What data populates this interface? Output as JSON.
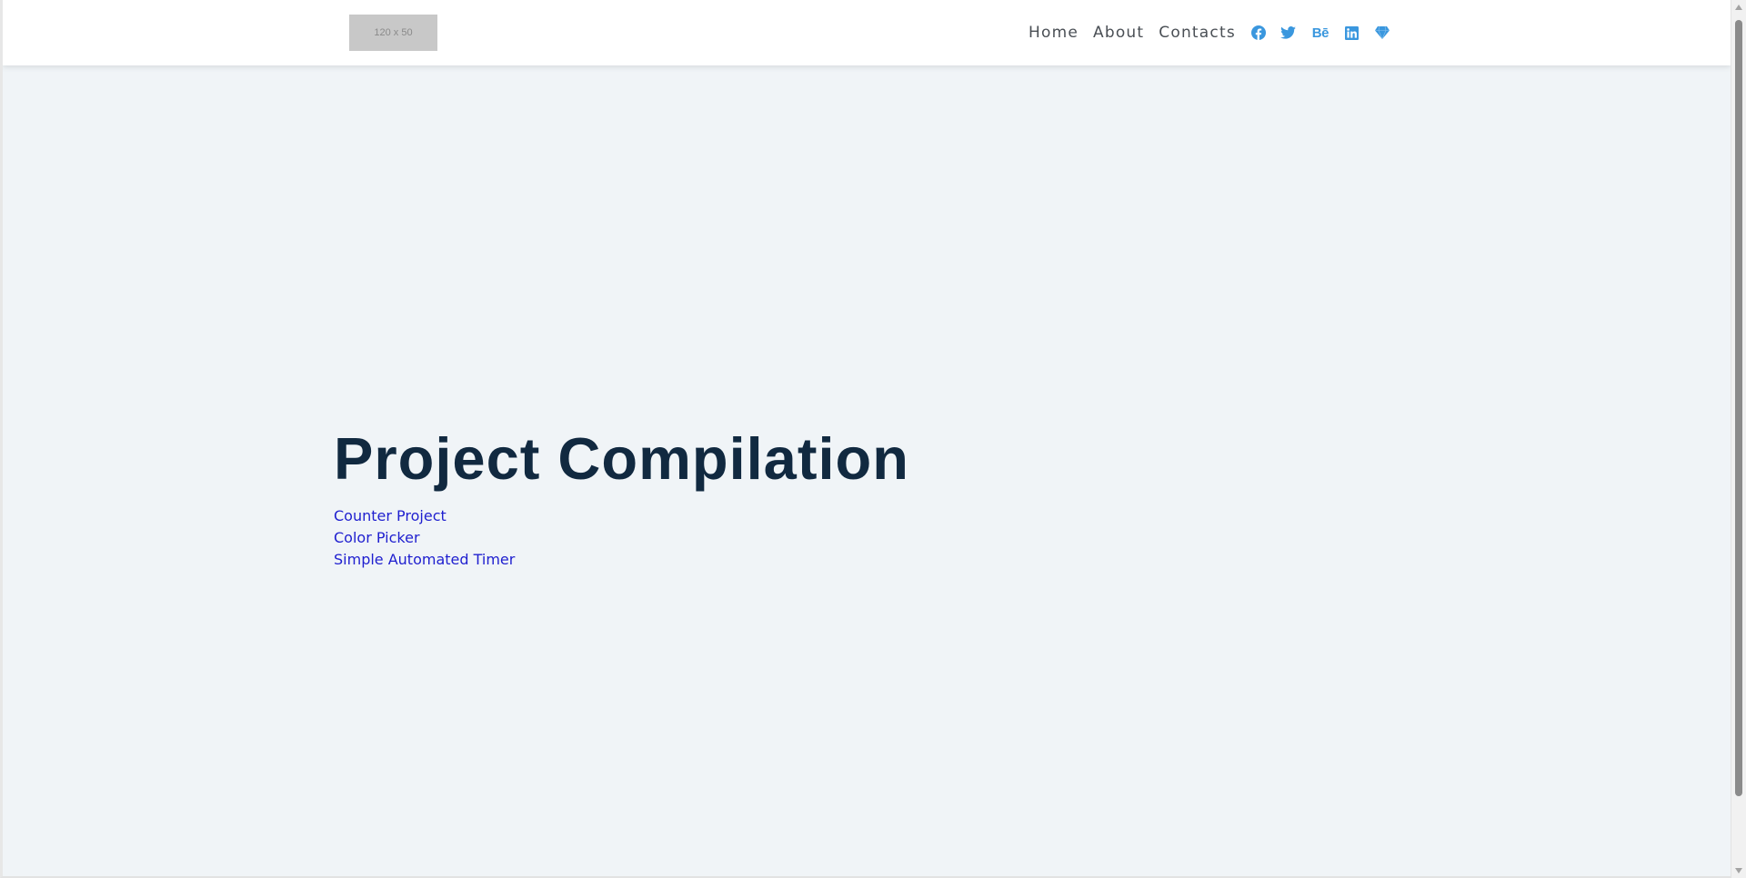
{
  "header": {
    "logo_text": "120 x 50",
    "nav": [
      {
        "label": "Home"
      },
      {
        "label": "About"
      },
      {
        "label": "Contacts"
      }
    ],
    "social": [
      {
        "icon": "facebook-icon"
      },
      {
        "icon": "twitter-icon"
      },
      {
        "icon": "behance-icon",
        "text": "Bē"
      },
      {
        "icon": "linkedin-icon"
      },
      {
        "icon": "diamond-icon"
      }
    ],
    "accent_color": "#3a97de"
  },
  "hero": {
    "title": "Project Compilation",
    "projects": [
      {
        "label": "Counter Project"
      },
      {
        "label": "Color Picker"
      },
      {
        "label": "Simple Automated Timer"
      }
    ]
  },
  "colors": {
    "background": "#f0f4f7",
    "title": "#112940",
    "link": "#1f1fcf"
  }
}
